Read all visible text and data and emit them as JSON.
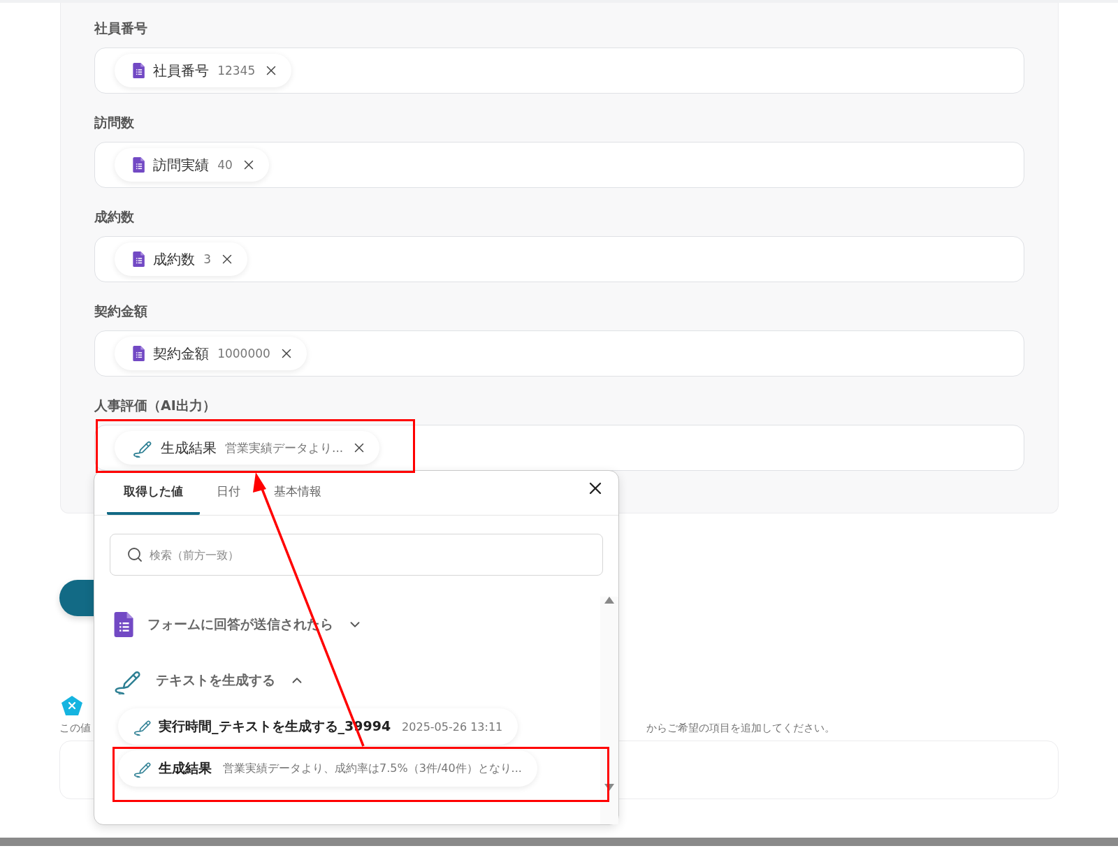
{
  "fields": [
    {
      "label": "社員番号",
      "token": {
        "kind": "form",
        "name": "社員番号",
        "value": "12345"
      }
    },
    {
      "label": "訪問数",
      "token": {
        "kind": "form",
        "name": "訪問実績",
        "value": "40"
      }
    },
    {
      "label": "成約数",
      "token": {
        "kind": "form",
        "name": "成約数",
        "value": "3"
      }
    },
    {
      "label": "契約金額",
      "token": {
        "kind": "form",
        "name": "契約金額",
        "value": "1000000"
      }
    },
    {
      "label": "人事評価（AI出力）",
      "token": {
        "kind": "ai",
        "name": "生成結果",
        "value": "営業実績データより..."
      }
    }
  ],
  "section": {
    "note_start": "この値",
    "note_end": "からご希望の項目を追加してください。"
  },
  "picker": {
    "tabs": [
      {
        "label": "取得した値",
        "selected": true
      },
      {
        "label": "日付",
        "selected": false
      },
      {
        "label": "基本情報",
        "selected": false
      }
    ],
    "search": {
      "placeholder": "検索（前方一致）"
    },
    "groups": [
      {
        "kind": "form",
        "title": "フォームに回答が送信されたら",
        "expanded": false
      },
      {
        "kind": "ai",
        "title": "テキストを生成する",
        "expanded": true,
        "items": [
          {
            "name": "実行時間_テキストを生成する_39994",
            "value": "2025-05-26 13:11"
          },
          {
            "name": "生成結果",
            "value": "営業実績データより、成約率は7.5%（3件/40件）となり..."
          }
        ]
      }
    ]
  }
}
